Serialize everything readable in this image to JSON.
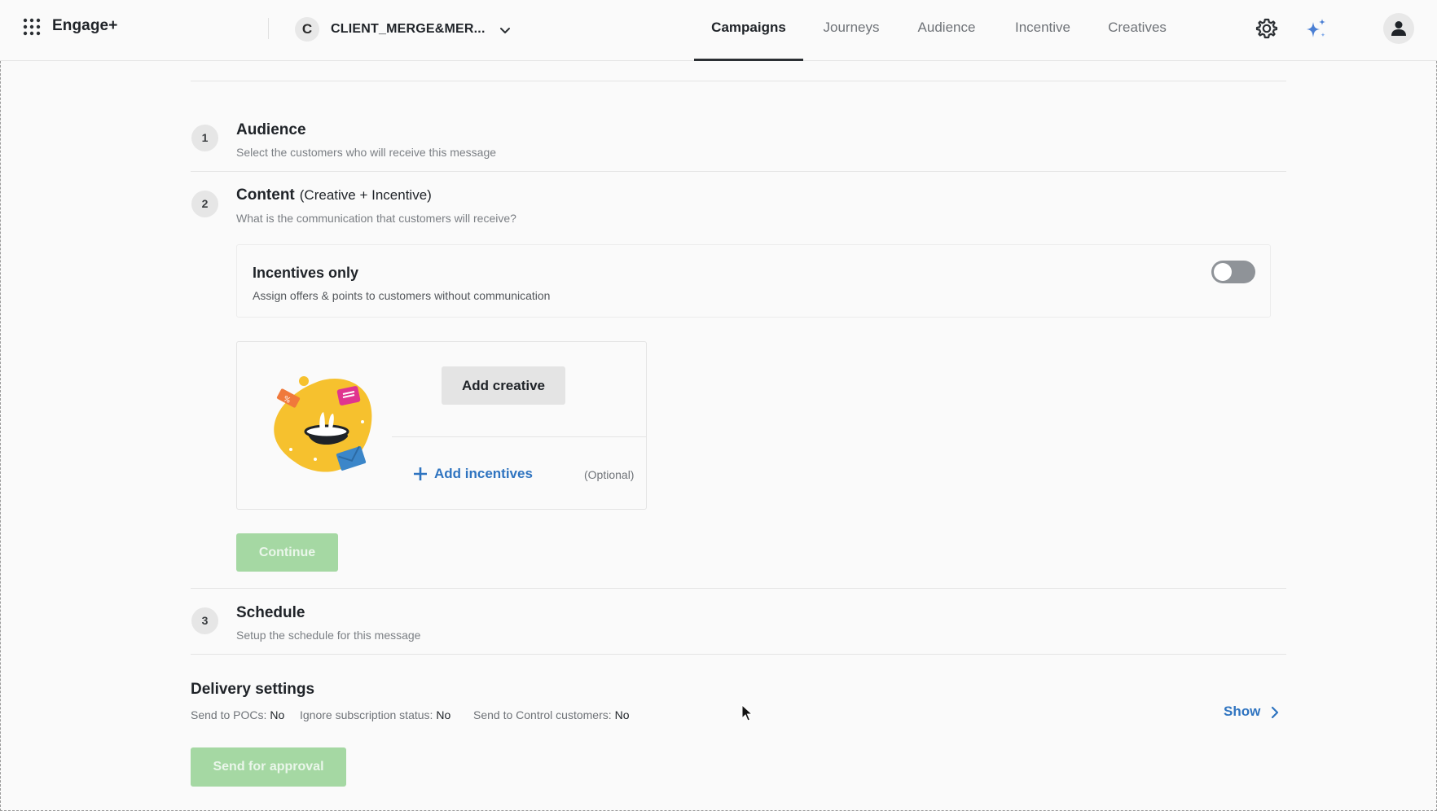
{
  "header": {
    "brand": "Engage+",
    "org": {
      "initial": "C",
      "name": "CLIENT_MERGE&MER..."
    },
    "tabs": [
      {
        "label": "Campaigns",
        "active": true
      },
      {
        "label": "Journeys",
        "active": false
      },
      {
        "label": "Audience",
        "active": false
      },
      {
        "label": "Incentive",
        "active": false
      },
      {
        "label": "Creatives",
        "active": false
      }
    ],
    "icons": [
      "apps-grid-icon",
      "chevron-down-icon",
      "gear-icon",
      "sparkle-icon",
      "user-icon"
    ]
  },
  "steps": [
    {
      "number": "1",
      "title": "Audience",
      "subtitle": "Select the customers who will receive this message"
    },
    {
      "number": "2",
      "title": "Content",
      "title_suffix": "(Creative + Incentive)",
      "subtitle": "What is the communication that customers will receive?"
    },
    {
      "number": "3",
      "title": "Schedule",
      "subtitle": "Setup the schedule for this message"
    }
  ],
  "content": {
    "incentives_only": {
      "title": "Incentives only",
      "description": "Assign offers & points to customers without communication",
      "enabled": false
    },
    "add_creative_label": "Add creative",
    "add_incentives_label": "Add incentives",
    "optional_label": "(Optional)",
    "continue_label": "Continue"
  },
  "delivery": {
    "title": "Delivery settings",
    "settings": [
      {
        "label": "Send to POCs:",
        "value": "No"
      },
      {
        "label": "Ignore subscription status:",
        "value": "No"
      },
      {
        "label": "Send to Control customers:",
        "value": "No"
      }
    ],
    "show_label": "Show"
  },
  "footer": {
    "send_for_approval_label": "Send for approval"
  },
  "colors": {
    "accent_blue": "#2f74c0",
    "disabled_green": "#a5d8a3",
    "illustration_yellow": "#f6c12e",
    "illustration_pink": "#e0358f",
    "illustration_orange": "#f0793b",
    "illustration_blue": "#3b86c9"
  }
}
